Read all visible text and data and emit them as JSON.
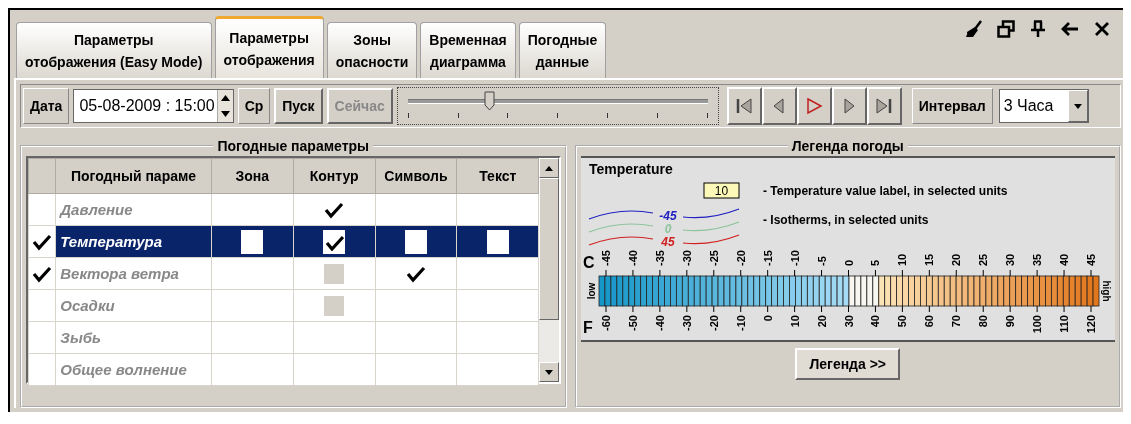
{
  "tabs": [
    {
      "label": "Параметры отображения (Easy Mode)",
      "selected": false
    },
    {
      "label": "Параметры отображения",
      "selected": true
    },
    {
      "label": "Зоны опасности",
      "selected": false
    },
    {
      "label": "Временная диаграмма",
      "selected": false
    },
    {
      "label": "Погодные данные",
      "selected": false
    }
  ],
  "toolbar": {
    "date_label": "Дата",
    "date_value": "05-08-2009 : 15:00",
    "weekday": "Ср",
    "start_button": "Пуск",
    "now_button": {
      "label": "Сейчас",
      "disabled": true
    },
    "time_slider": {
      "level": 0.27
    },
    "interval_label": "Интервал",
    "interval_value": "3 Часа"
  },
  "weather_parameters": {
    "title": "Погодные параметры",
    "columns": [
      "Погодный параме",
      "Зона",
      "Контур",
      "Символь",
      "Текст"
    ],
    "rows": [
      {
        "name": "Давление",
        "visible": false,
        "selected": false,
        "cells": [
          {
            "checked": false,
            "disabled": false
          },
          {
            "checked": true,
            "disabled": false
          },
          {
            "checked": false,
            "disabled": false
          },
          {
            "checked": false,
            "disabled": false
          }
        ]
      },
      {
        "name": "Температура",
        "visible": true,
        "selected": true,
        "cells": [
          {
            "checked": false,
            "disabled": false
          },
          {
            "checked": true,
            "disabled": false
          },
          {
            "checked": false,
            "disabled": false
          },
          {
            "checked": false,
            "disabled": false
          }
        ]
      },
      {
        "name": "Вектора ветра",
        "visible": true,
        "selected": false,
        "cells": [
          {
            "checked": false,
            "disabled": false
          },
          {
            "checked": false,
            "disabled": true
          },
          {
            "checked": true,
            "disabled": false
          },
          {
            "checked": false,
            "disabled": false
          }
        ]
      },
      {
        "name": "Осадки",
        "visible": false,
        "selected": false,
        "cells": [
          {
            "checked": false,
            "disabled": false
          },
          {
            "checked": false,
            "disabled": true
          },
          {
            "checked": false,
            "disabled": false
          },
          {
            "checked": false,
            "disabled": false
          }
        ]
      },
      {
        "name": "Зыбь",
        "visible": false,
        "selected": false,
        "cells": [
          {
            "checked": false,
            "disabled": false
          },
          {
            "checked": false,
            "disabled": false
          },
          {
            "checked": false,
            "disabled": false
          },
          {
            "checked": false,
            "disabled": false
          }
        ]
      },
      {
        "name": "Общее волнение",
        "visible": false,
        "selected": false,
        "cells": [
          {
            "checked": false,
            "disabled": false
          },
          {
            "checked": false,
            "disabled": false
          },
          {
            "checked": false,
            "disabled": false
          },
          {
            "checked": false,
            "disabled": false
          }
        ]
      }
    ]
  },
  "weather_legend": {
    "title": "Легенда погоды",
    "heading": "Temperature",
    "value_label_sample": "10",
    "value_label_text": "- Temperature value label, in selected units",
    "isotherms": [
      {
        "label": "-45",
        "color": "#2020c0"
      },
      {
        "label": "0",
        "color": "#8cc49c"
      },
      {
        "label": "45",
        "color": "#d02020"
      }
    ],
    "isotherm_text": "- Isotherms, in selected units",
    "scale": {
      "celsius_label": "C",
      "fahrenheit_label": "F",
      "low_label": "low",
      "high_label": "high",
      "celsius_ticks": [
        "-45",
        "-40",
        "-35",
        "-30",
        "-25",
        "-20",
        "-15",
        "-10",
        "-5",
        "0",
        "5",
        "10",
        "15",
        "20",
        "25",
        "30",
        "35",
        "40",
        "45"
      ],
      "fahrenheit_ticks": [
        "-60",
        "-50",
        "-40",
        "-30",
        "-20",
        "-10",
        "0",
        "10",
        "20",
        "30",
        "40",
        "50",
        "60",
        "70",
        "80",
        "90",
        "100",
        "110",
        "120"
      ]
    },
    "button": "Легенда >>"
  }
}
